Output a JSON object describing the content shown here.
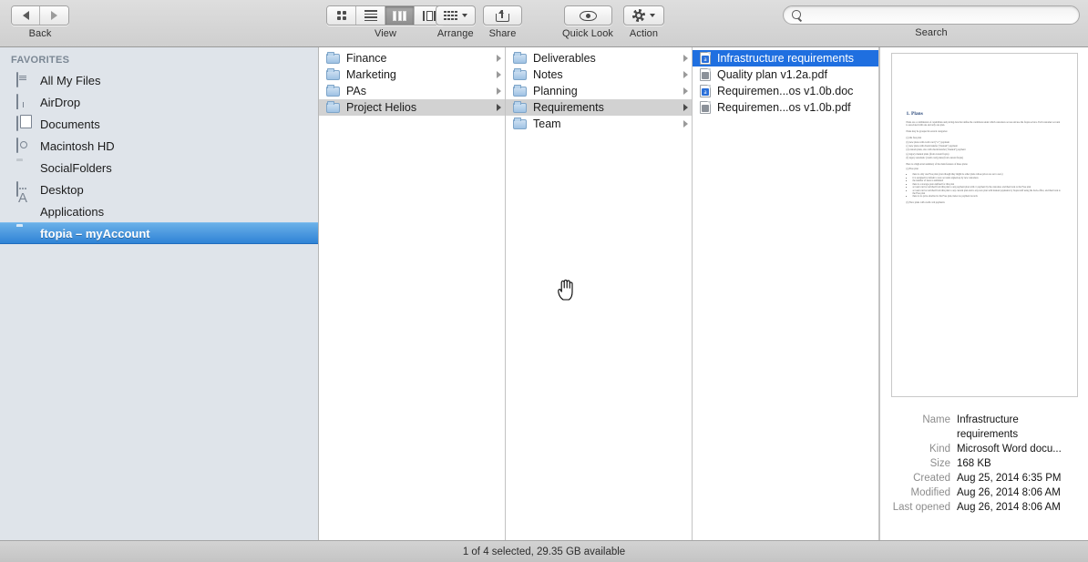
{
  "toolbar": {
    "nav": {
      "back_label": "Back",
      "back_icon": "triangle-left-icon",
      "forward_icon": "triangle-right-icon"
    },
    "view": {
      "label": "View",
      "options": [
        "icon-view",
        "list-view",
        "column-view",
        "coverflow-view"
      ],
      "selected": "column-view"
    },
    "arrange": {
      "label": "Arrange",
      "icon": "grid-dots-icon"
    },
    "share": {
      "label": "Share",
      "icon": "share-arrow-icon"
    },
    "quick_look": {
      "label": "Quick Look",
      "icon": "eye-icon"
    },
    "action": {
      "label": "Action",
      "icon": "gear-icon"
    },
    "search": {
      "label": "Search",
      "placeholder": "",
      "value": "",
      "icon": "search-icon"
    }
  },
  "sidebar": {
    "section_title": "FAVORITES",
    "items": [
      {
        "label": "All My Files",
        "icon": "all-my-files-icon",
        "selected": false
      },
      {
        "label": "AirDrop",
        "icon": "airdrop-icon",
        "selected": false
      },
      {
        "label": "Documents",
        "icon": "documents-icon",
        "selected": false
      },
      {
        "label": "Macintosh HD",
        "icon": "hard-disk-icon",
        "selected": false
      },
      {
        "label": "SocialFolders",
        "icon": "folder-icon",
        "selected": false
      },
      {
        "label": "Desktop",
        "icon": "desktop-icon",
        "selected": false
      },
      {
        "label": "Applications",
        "icon": "applications-icon",
        "selected": false
      },
      {
        "label": "ftopia – myAccount",
        "icon": "folder-icon",
        "selected": true
      }
    ]
  },
  "columns": [
    {
      "name": "column-1",
      "rows": [
        {
          "label": "Finance",
          "icon": "folder-icon",
          "has_children": true,
          "state": "none"
        },
        {
          "label": "Marketing",
          "icon": "folder-icon",
          "has_children": true,
          "state": "none"
        },
        {
          "label": "PAs",
          "icon": "folder-icon",
          "has_children": true,
          "state": "none"
        },
        {
          "label": "Project Helios",
          "icon": "folder-icon",
          "has_children": true,
          "state": "grey"
        }
      ]
    },
    {
      "name": "column-2",
      "rows": [
        {
          "label": "Deliverables",
          "icon": "folder-icon",
          "has_children": true,
          "state": "none"
        },
        {
          "label": "Notes",
          "icon": "folder-icon",
          "has_children": true,
          "state": "none"
        },
        {
          "label": "Planning",
          "icon": "folder-icon",
          "has_children": true,
          "state": "none"
        },
        {
          "label": "Requirements",
          "icon": "folder-icon",
          "has_children": true,
          "state": "grey"
        },
        {
          "label": "Team",
          "icon": "folder-icon",
          "has_children": true,
          "state": "none"
        }
      ]
    },
    {
      "name": "column-3",
      "rows": [
        {
          "label": "Infrastructure requirements",
          "icon": "word-document-icon",
          "badge": "a",
          "has_children": false,
          "state": "blue"
        },
        {
          "label": "Quality plan v1.2a.pdf",
          "icon": "pdf-document-icon",
          "badge": "",
          "has_children": false,
          "state": "none"
        },
        {
          "label": "Requiremen...os v1.0b.doc",
          "icon": "word-document-icon",
          "badge": "a",
          "has_children": false,
          "state": "none"
        },
        {
          "label": "Requiremen...os v1.0b.pdf",
          "icon": "pdf-document-icon",
          "badge": "",
          "has_children": false,
          "state": "none"
        }
      ]
    }
  ],
  "preview": {
    "thumbnail": {
      "heading": "1. Plans",
      "paragraphs": [
        "Plans are a combination of capabilities and pricing data that define the conditions under which customers access and use the ftopia service. Each customer account is associated with one and only one plan.",
        "Plans may be grouped in several categories:",
        "Here is a high-level summary of the main features of these plans:"
      ],
      "list_a": [
        "(a) the free plan",
        "(b) new plans with credit card (\"cc\") payment",
        "(c) new plans with check/transfer (\"manual\") payment",
        "(d) custom plans, also with check/transfer (\"manual\") payment",
        "(e) legacy manual plans (from current ftopia)",
        "(f) legacy automatic (credit card) plans (from current ftopia)"
      ],
      "sub_heading": "(a) Free plan",
      "bullets": [
        "there is only one Free plan (even though they might be other plans whose prices are set to zero)",
        "it is assigned by default to new accounts signed-up by new customers",
        "the number of users is unlimited",
        "there is a storage quota defined for this plan",
        "account can be switched from this plan to any payment plan with cc payment by the customer, and then back to the Free plan",
        "account can be switched from this plan to any custom plan and to any new plan with manual payments by ftopia staff using the back-office, and then back to the Free plan",
        "there is no price attached to the Free plan, hence no payment records"
      ],
      "footer": "(b) New plans with credit card payments"
    },
    "metadata": [
      {
        "label": "Name",
        "value": "Infrastructure requirements"
      },
      {
        "label": "Kind",
        "value": "Microsoft Word docu..."
      },
      {
        "label": "Size",
        "value": "168 KB"
      },
      {
        "label": "Created",
        "value": "Aug 25, 2014 6:35 PM"
      },
      {
        "label": "Modified",
        "value": "Aug 26, 2014 8:06 AM"
      },
      {
        "label": "Last opened",
        "value": "Aug 26, 2014 8:06 AM"
      }
    ]
  },
  "status_bar": {
    "text": "1 of 4 selected, 29.35 GB available"
  },
  "cursor": {
    "type": "pointing-hand"
  },
  "colors": {
    "selection_blue": "#1f6fe0",
    "sidebar_selection_blue": "#2f83d6",
    "sidebar_background": "#dfe4ea",
    "toolbar_background": "#d6d6d6"
  }
}
